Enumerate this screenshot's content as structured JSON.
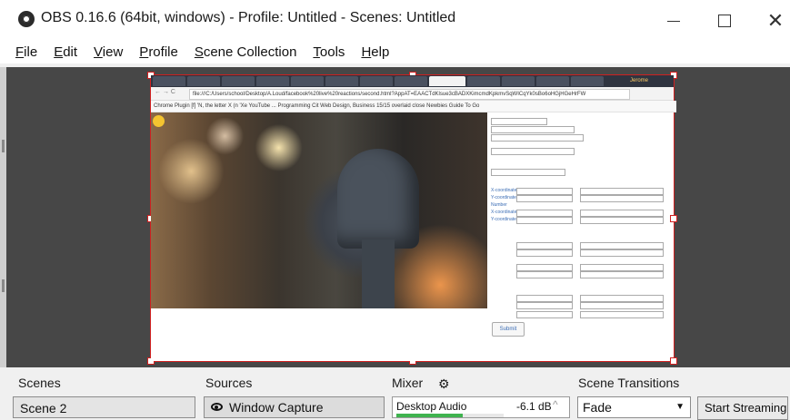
{
  "window": {
    "title": "OBS 0.16.6 (64bit, windows) - Profile: Untitled - Scenes: Untitled"
  },
  "menu": {
    "items": [
      {
        "accel": "F",
        "rest": "ile"
      },
      {
        "accel": "E",
        "rest": "dit"
      },
      {
        "accel": "V",
        "rest": "iew"
      },
      {
        "accel": "P",
        "rest": "rofile"
      },
      {
        "accel": "S",
        "rest": "cene Collection"
      },
      {
        "accel": "T",
        "rest": "ools"
      },
      {
        "accel": "H",
        "rest": "elp"
      }
    ]
  },
  "capture": {
    "user": "Jerome",
    "address": "file:///C:/Users/school/Desktop/A.Loud/facebook%20live%20reactions/second.html?AppAT=EAACTdKlsue3cBADXKimcmdKpkmvSqWICqYk0sBo6oHGjHGeHrFW",
    "bookmarks": "Chrome Plugin   [f] 'N, the letter X (n 'Xe   YouTube ...   Programming   Cit   Web Design, Business   15/15 overlaid close   Newbies Guide To Go",
    "form_field_labels": [
      "X-coordinate",
      "Y-coordinate",
      "Number",
      "X-coordinate",
      "Y-coordinate"
    ],
    "submit_label": "Submit"
  },
  "docks": {
    "scenes": {
      "title": "Scenes",
      "items": [
        "Scene 2"
      ]
    },
    "sources": {
      "title": "Sources",
      "items": [
        "Window Capture"
      ]
    },
    "mixer": {
      "title": "Mixer",
      "channels": [
        {
          "name": "Desktop Audio",
          "level_db": "-6.1 dB",
          "meter_fill": 0.62
        }
      ]
    },
    "transitions": {
      "title": "Scene Transitions",
      "selected": "Fade"
    },
    "controls": {
      "start_streaming": "Start Streaming"
    }
  },
  "colors": {
    "selection_outline": "#d02020",
    "meter_green": "#3fb34f"
  }
}
